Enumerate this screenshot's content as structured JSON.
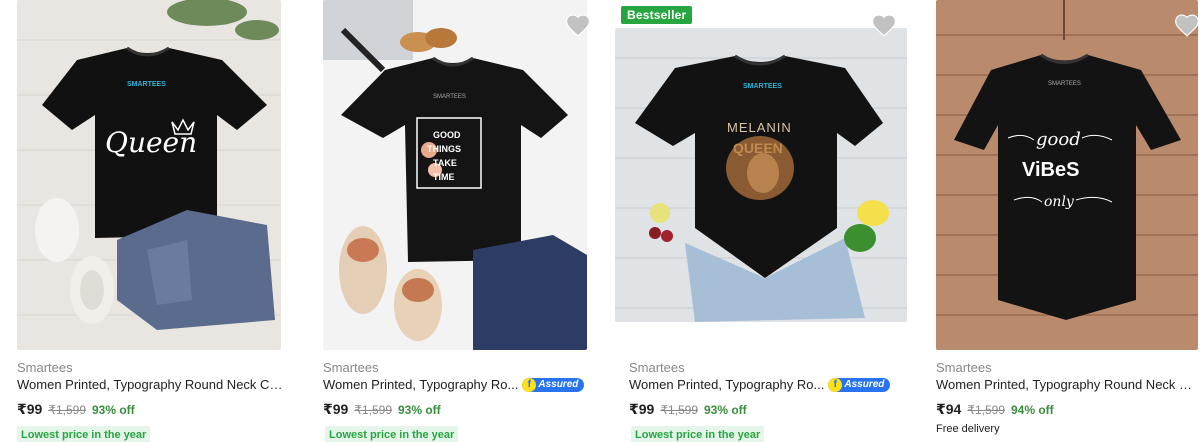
{
  "products": [
    {
      "brand": "Smartees",
      "title": "Women Printed, Typography Round Neck Cot...",
      "price": "₹99",
      "mrp": "₹1,599",
      "discount": "93% off",
      "promo": "Lowest price in the year",
      "print_text": "Queen",
      "label": "SMARTEES",
      "assured": false
    },
    {
      "brand": "Smartees",
      "title": "Women Printed, Typography Ro...",
      "price": "₹99",
      "mrp": "₹1,599",
      "discount": "93% off",
      "promo": "Lowest price in the year",
      "assured_label": "Assured",
      "assured_icon": "flipkart-f-icon",
      "print_lines": [
        "GOOD",
        "THINGS",
        "TAKE",
        "TIME"
      ],
      "label": "SMARTEES",
      "assured": true
    },
    {
      "brand": "Smartees",
      "title": "Women Printed, Typography Ro...",
      "price": "₹99",
      "mrp": "₹1,599",
      "discount": "93% off",
      "promo": "Lowest price in the year",
      "badge": "Bestseller",
      "assured_label": "Assured",
      "assured_icon": "flipkart-f-icon",
      "print_lines": [
        "MELANIN",
        "QUEEN"
      ],
      "label": "SMARTEES",
      "assured": true
    },
    {
      "brand": "Smartees",
      "title": "Women Printed, Typography Round Neck Cot...",
      "price": "₹94",
      "mrp": "₹1,599",
      "discount": "94% off",
      "delivery": "Free delivery",
      "print_lines": [
        "good",
        "ViBeS",
        "only"
      ],
      "label": "SMARTEES",
      "assured": false
    }
  ],
  "icons": {
    "wishlist": "heart-icon"
  },
  "colors": {
    "discount_green": "#388e3c",
    "promo_green": "#26a541",
    "promo_bg": "#e6f5ea",
    "assured_blue": "#2874f0",
    "heart_grey": "#c2c2c2"
  }
}
